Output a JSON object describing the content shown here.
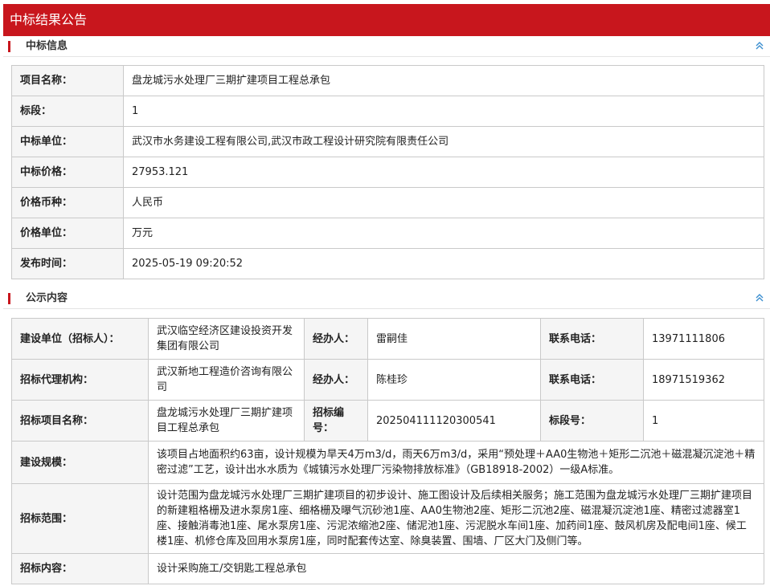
{
  "page": {
    "title": "中标结果公告"
  },
  "sections": {
    "award": {
      "title": "中标信息",
      "collapse_icon": "double-chevron-up-icon"
    },
    "content": {
      "title": "公示内容",
      "collapse_icon": "double-chevron-up-icon"
    }
  },
  "award_info": [
    {
      "label": "项目名称：",
      "value": "盘龙城污水处理厂三期扩建项目工程总承包"
    },
    {
      "label": "标段：",
      "value": "1"
    },
    {
      "label": "中标单位：",
      "value": "武汉市水务建设工程有限公司,武汉市政工程设计研究院有限责任公司"
    },
    {
      "label": "中标价格：",
      "value": "27953.121"
    },
    {
      "label": "价格币种：",
      "value": "人民币"
    },
    {
      "label": "价格单位：",
      "value": "万元"
    },
    {
      "label": "发布时间：",
      "value": "2025-05-19 09:20:52"
    }
  ],
  "content_info": {
    "rows4": [
      {
        "l1": "建设单位（招标人）：",
        "v1": "武汉临空经济区建设投资开发集团有限公司",
        "l2": "经办人：",
        "v2": "雷嗣佳",
        "l3": "联系电话：",
        "v3": "13971111806"
      },
      {
        "l1": "招标代理机构：",
        "v1": "武汉新地工程造价咨询有限公司",
        "l2": "经办人：",
        "v2": "陈桂珍",
        "l3": "联系电话：",
        "v3": "18971519362"
      },
      {
        "l1": "招标项目名称：",
        "v1": "盘龙城污水处理厂三期扩建项目工程总承包",
        "l2": "招标编号：",
        "v2": "202504111120300541",
        "l3": "标段号：",
        "v3": "1"
      }
    ],
    "scale": {
      "label": "建设规模：",
      "value": "该项目占地面积约63亩，设计规模为旱天4万m3/d，雨天6万m3/d，采用“预处理＋AA0生物池＋矩形二沉池＋磁混凝沉淀池＋精密过滤”工艺，设计出水水质为《城镇污水处理厂污染物排放标准》（GB18918-2002）一级A标准。"
    },
    "scope": {
      "label": "招标范围：",
      "value": "设计范围为盘龙城污水处理厂三期扩建项目的初步设计、施工图设计及后续相关服务；施工范围为盘龙城污水处理厂三期扩建项目的新建粗格栅及进水泵房1座、细格栅及曝气沉砂池1座、AA0生物池2座、矩形二沉池2座、磁混凝沉淀池1座、精密过滤器室1座、接触消毒池1座、尾水泵房1座、污泥浓缩池2座、储泥池1座、污泥脱水车间1座、加药间1座、鼓风机房及配电间1座、候工楼1座、机修仓库及回用水泵房1座，同时配套传达室、除臭装置、围墙、厂区大门及侧门等。"
    },
    "content": {
      "label": "招标内容：",
      "value": "设计采购施工/交钥匙工程总承包"
    }
  }
}
